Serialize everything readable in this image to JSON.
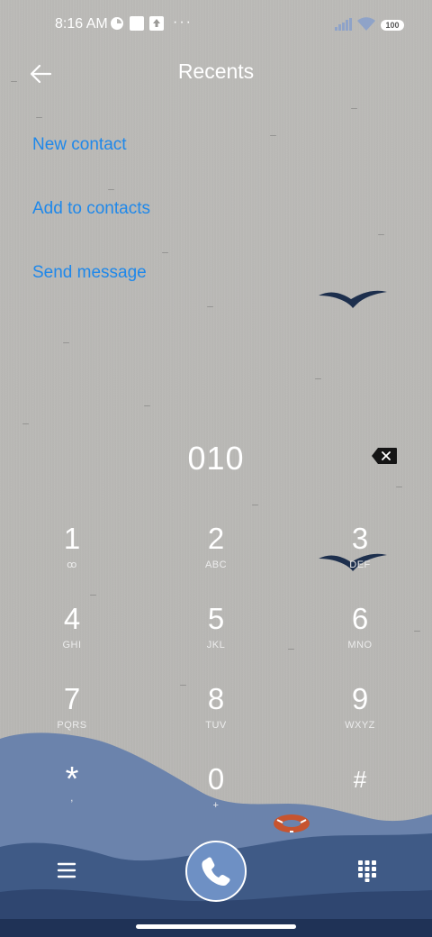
{
  "status_bar": {
    "time": "8:16 AM",
    "overflow": "···",
    "battery": "100",
    "icons": [
      "data-saver-icon",
      "square-notification-icon",
      "upload-notification-icon",
      "signal-icon",
      "wifi-icon",
      "battery-icon"
    ]
  },
  "header": {
    "title": "Recents",
    "back_icon": "back-arrow-icon"
  },
  "actions": [
    {
      "label": "New contact"
    },
    {
      "label": "Add to contacts"
    },
    {
      "label": "Send message"
    }
  ],
  "dialer": {
    "number": "010",
    "backspace_icon": "backspace-icon"
  },
  "keypad": [
    {
      "digit": "1",
      "letters": "ꝏ"
    },
    {
      "digit": "2",
      "letters": "ABC"
    },
    {
      "digit": "3",
      "letters": "DEF"
    },
    {
      "digit": "4",
      "letters": "GHI"
    },
    {
      "digit": "5",
      "letters": "JKL"
    },
    {
      "digit": "6",
      "letters": "MNO"
    },
    {
      "digit": "7",
      "letters": "PQRS"
    },
    {
      "digit": "8",
      "letters": "TUV"
    },
    {
      "digit": "9",
      "letters": "WXYZ"
    },
    {
      "digit": "*",
      "letters": ","
    },
    {
      "digit": "0",
      "letters": "+"
    },
    {
      "digit": "#",
      "letters": ""
    }
  ],
  "bottom_bar": {
    "menu_icon": "menu-icon",
    "call_icon": "phone-icon",
    "dialpad_icon": "dialpad-icon"
  },
  "colors": {
    "accent": "#1f88ea",
    "background": "#b9b8b5",
    "call_button": "#6e90c4",
    "wave_light": "#6b83ac",
    "wave_dark": "#2f4670"
  }
}
